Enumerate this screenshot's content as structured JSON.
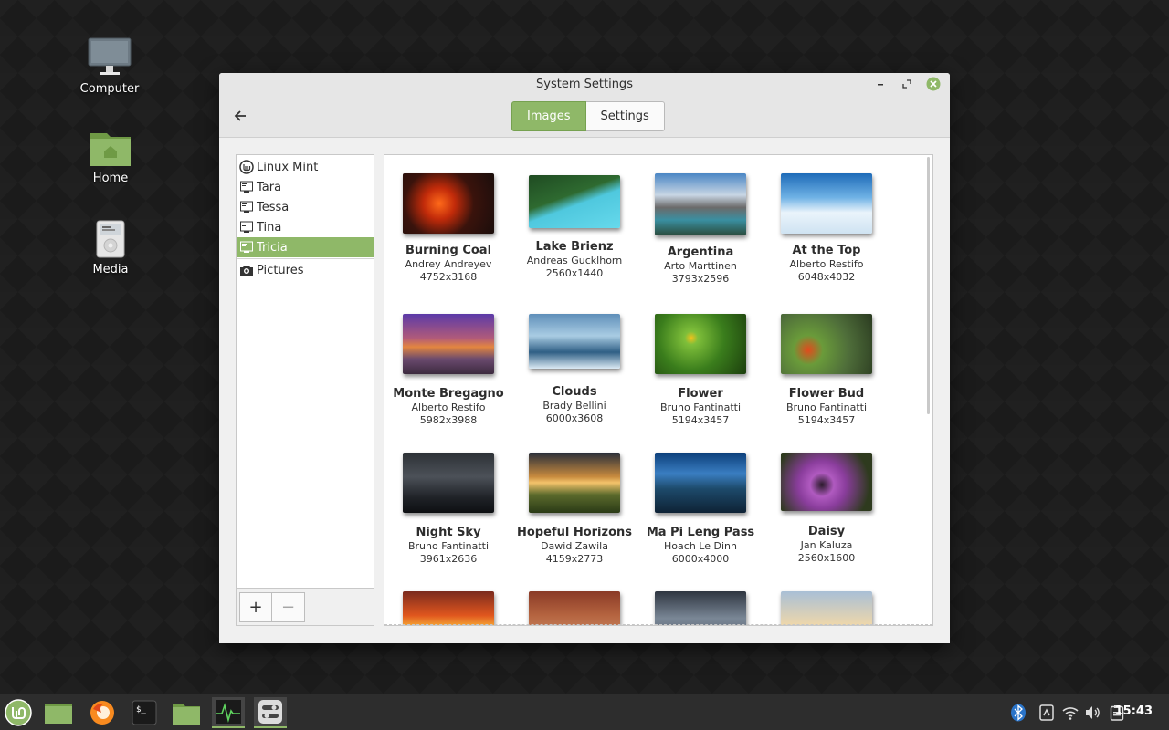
{
  "desktop": {
    "icons": [
      {
        "label": "Computer"
      },
      {
        "label": "Home"
      },
      {
        "label": "Media"
      }
    ]
  },
  "window": {
    "title": "System Settings",
    "tabs": [
      {
        "label": "Images",
        "active": true
      },
      {
        "label": "Settings",
        "active": false
      }
    ]
  },
  "sidebar": {
    "items": [
      {
        "label": "Linux Mint",
        "icon": "mint-logo-icon"
      },
      {
        "label": "Tara",
        "icon": "monitor-icon"
      },
      {
        "label": "Tessa",
        "icon": "monitor-icon"
      },
      {
        "label": "Tina",
        "icon": "monitor-icon"
      },
      {
        "label": "Tricia",
        "icon": "monitor-icon",
        "selected": true
      },
      {
        "label": "Pictures",
        "icon": "camera-icon"
      }
    ],
    "add_label": "+",
    "remove_label": "−"
  },
  "wallpapers": [
    {
      "name": "Burning Coal",
      "author": "Andrey Andreyev",
      "size": "4752x3168"
    },
    {
      "name": "Lake Brienz",
      "author": "Andreas Gucklhorn",
      "size": "2560x1440"
    },
    {
      "name": "Argentina",
      "author": "Arto Marttinen",
      "size": "3793x2596"
    },
    {
      "name": "At the Top",
      "author": "Alberto Restifo",
      "size": "6048x4032"
    },
    {
      "name": "Monte Bregagno",
      "author": "Alberto Restifo",
      "size": "5982x3988"
    },
    {
      "name": "Clouds",
      "author": "Brady Bellini",
      "size": "6000x3608"
    },
    {
      "name": "Flower",
      "author": "Bruno Fantinatti",
      "size": "5194x3457"
    },
    {
      "name": "Flower Bud",
      "author": "Bruno Fantinatti",
      "size": "5194x3457"
    },
    {
      "name": "Night Sky",
      "author": "Bruno Fantinatti",
      "size": "3961x2636"
    },
    {
      "name": "Hopeful Horizons",
      "author": "Dawid Zawila",
      "size": "4159x2773"
    },
    {
      "name": "Ma Pi Leng Pass",
      "author": "Hoach Le Dinh",
      "size": "6000x4000"
    },
    {
      "name": "Daisy",
      "author": "Jan Kaluza",
      "size": "2560x1600"
    }
  ],
  "taskbar": {
    "apps": [
      "mint-menu-icon",
      "show-desktop-icon",
      "firefox-icon",
      "terminal-icon",
      "files-icon",
      "system-monitor-icon",
      "system-settings-icon"
    ],
    "tray": [
      "bluetooth-icon",
      "update-manager-icon",
      "wifi-icon",
      "volume-icon",
      "clipboard-icon"
    ],
    "clock": "15:43"
  },
  "colors": {
    "accent": "#8fb868",
    "taskbar": "#2d2d2d"
  }
}
